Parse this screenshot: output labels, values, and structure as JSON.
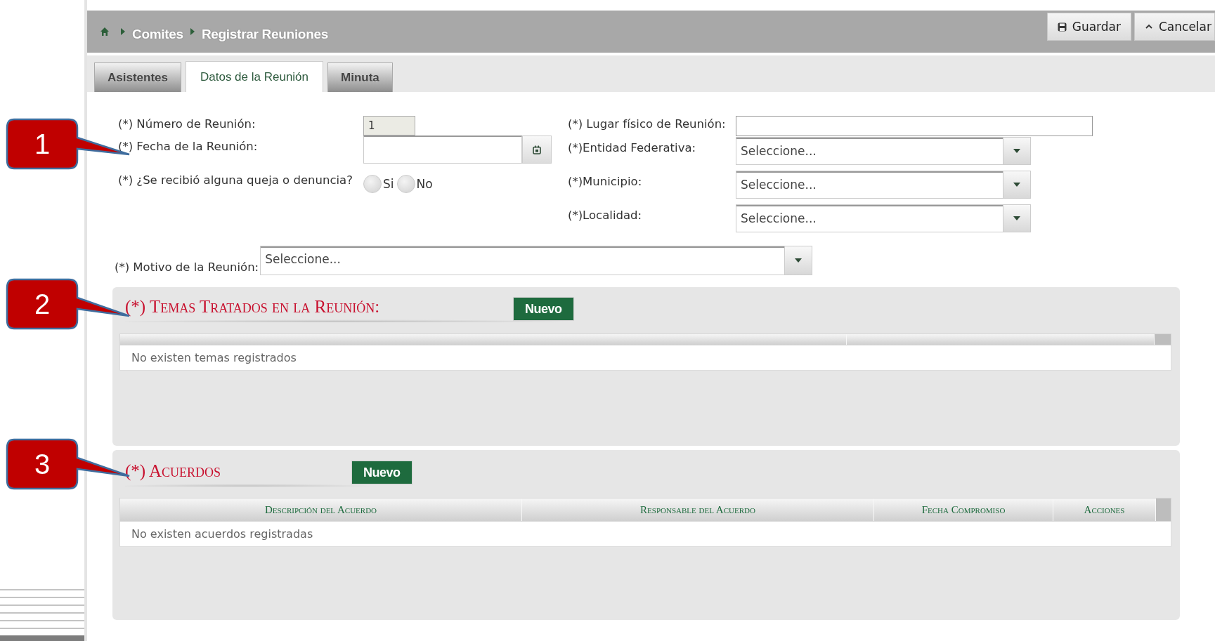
{
  "header": {
    "breadcrumb": [
      "Comites",
      "Registrar Reuniones"
    ],
    "buttons": [
      {
        "kind": "save",
        "label": "Guardar"
      },
      {
        "kind": "cancel",
        "label": "Cancelar"
      }
    ]
  },
  "tabs": [
    {
      "label": "Asistentes",
      "selected": false
    },
    {
      "label": "Datos de la Reunión",
      "selected": true
    },
    {
      "label": "Minuta",
      "selected": false
    }
  ],
  "form": {
    "left": [
      {
        "kind": "text",
        "label": "(*) Número de Reunión:",
        "value": "1",
        "disabled": true
      },
      {
        "kind": "date",
        "label": "(*) Fecha de la Reunión:"
      },
      {
        "kind": "radio",
        "label": "(*) ¿Se recibió alguna queja o denuncia?",
        "options": [
          {
            "label": "Si",
            "selected": false
          },
          {
            "label": "No",
            "selected": false
          }
        ]
      }
    ],
    "right": [
      {
        "kind": "text",
        "label": "(*) Lugar físico de Reunión:",
        "disabled": false
      },
      {
        "kind": "select",
        "label": "(*)Entidad Federativa:",
        "value": "Seleccione..."
      },
      {
        "kind": "select",
        "label": "(*)Municipio:",
        "value": "Seleccione..."
      },
      {
        "kind": "select",
        "label": "(*)Localidad:",
        "value": "Seleccione..."
      }
    ]
  },
  "motivo": {
    "label": "(*) Motivo de la Reunión:",
    "value": "Seleccione..."
  },
  "sections": [
    {
      "title": "(*) Temas Tratados en la Reunión:",
      "button": "Nuevo",
      "empty_text": "No existen temas registrados"
    },
    {
      "title": "(*) Acuerdos",
      "button": "Nuevo",
      "columns": [
        "Descripción del Acuerdo",
        "Responsable del Acuerdo",
        "Fecha Compromiso",
        "Acciones"
      ],
      "empty_text": "No existen acuerdos registradas"
    }
  ],
  "callouts": [
    {
      "number": "1"
    },
    {
      "number": "2"
    },
    {
      "number": "3"
    }
  ]
}
